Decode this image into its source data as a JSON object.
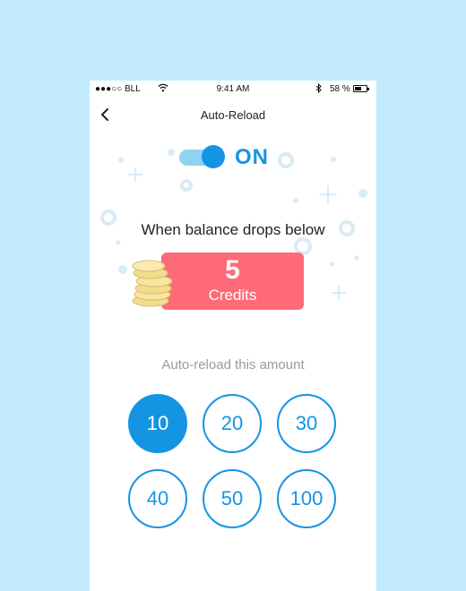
{
  "status_bar": {
    "carrier": "●●●○○ BLL",
    "time": "9:41 AM",
    "battery_percent": "58 %",
    "battery_level": 0.58
  },
  "nav": {
    "title": "Auto-Reload",
    "back_icon": "chevron-left-icon"
  },
  "toggle": {
    "state_label": "ON",
    "is_on": true
  },
  "threshold": {
    "label": "When balance drops below",
    "value": "5",
    "unit": "Credits"
  },
  "reload": {
    "label": "Auto-reload this amount",
    "options": [
      "10",
      "20",
      "30",
      "40",
      "50",
      "100"
    ],
    "selected": "10"
  },
  "colors": {
    "background": "#c2ebfd",
    "accent": "#1694e4",
    "toggle_track": "#8fd2f2",
    "credits_card": "#ff6a78"
  }
}
